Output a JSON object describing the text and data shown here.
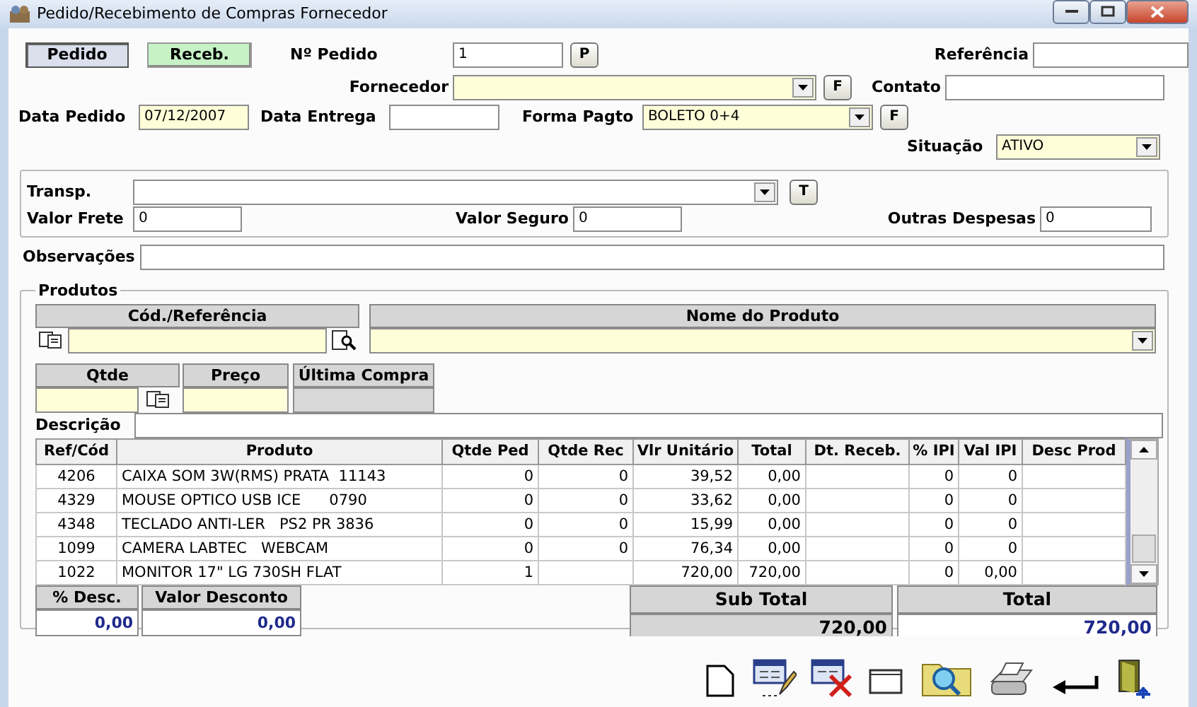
{
  "window": {
    "title": "Pedido/Recebimento de Compras Fornecedor"
  },
  "tabs": [
    {
      "label": "Pedido",
      "selected": true
    },
    {
      "label": "Receb.",
      "selected": false
    }
  ],
  "order": {
    "number": {
      "label": "Nº Pedido",
      "value": "1",
      "button": "P"
    },
    "reference": {
      "label": "Referência"
    },
    "supplier": {
      "label": "Fornecedor",
      "button": "F"
    },
    "contact": {
      "label": "Contato"
    },
    "order_date": {
      "label": "Data Pedido",
      "value": "07/12/2007"
    },
    "delivery_date": {
      "label": "Data Entrega"
    },
    "payment": {
      "label": "Forma Pagto",
      "value": "BOLETO 0+4",
      "button": "F"
    },
    "status": {
      "label": "Situação",
      "value": "ATIVO"
    }
  },
  "transport": {
    "carrier": {
      "label": "Transp.",
      "button": "T"
    },
    "freight": {
      "label": "Valor Frete",
      "value": "0"
    },
    "insurance": {
      "label": "Valor Seguro",
      "value": "0"
    },
    "other": {
      "label": "Outras Despesas",
      "value": "0"
    }
  },
  "notes": {
    "label": "Observações"
  },
  "products": {
    "title": "Produtos",
    "code_header": "Cód./Referência",
    "name_header": "Nome do Produto",
    "qty_header": "Qtde",
    "price_header": "Preço",
    "last_header": "Última Compra",
    "description_label": "Descrição",
    "table": {
      "columns": [
        "Ref/Cód",
        "Produto",
        "Qtde Ped",
        "Qtde Rec",
        "Vlr Unitário",
        "Total",
        "Dt. Receb.",
        "% IPI",
        "Val IPI",
        "Desc Prod"
      ],
      "rows": [
        {
          "ref": "4206",
          "produto": "CAIXA SOM 3W(RMS) PRATA  11143",
          "qtde_ped": "0",
          "qtde_rec": "0",
          "vlr_unitario": "39,52",
          "total": "0,00",
          "pct_ipi": "0",
          "val_ipi": "0"
        },
        {
          "ref": "4329",
          "produto": "MOUSE OPTICO USB ICE      0790",
          "qtde_ped": "0",
          "qtde_rec": "0",
          "vlr_unitario": "33,62",
          "total": "0,00",
          "pct_ipi": "0",
          "val_ipi": "0"
        },
        {
          "ref": "4348",
          "produto": "TECLADO ANTI-LER   PS2 PR 3836",
          "qtde_ped": "0",
          "qtde_rec": "0",
          "vlr_unitario": "15,99",
          "total": "0,00",
          "pct_ipi": "0",
          "val_ipi": "0"
        },
        {
          "ref": "1099",
          "produto": "CAMERA LABTEC   WEBCAM",
          "qtde_ped": "0",
          "qtde_rec": "0",
          "vlr_unitario": "76,34",
          "total": "0,00",
          "pct_ipi": "0",
          "val_ipi": "0"
        },
        {
          "ref": "1022",
          "produto": "MONITOR 17\" LG 730SH FLAT",
          "qtde_ped": "1",
          "vlr_unitario": "720,00",
          "total": "720,00",
          "pct_ipi": "0",
          "val_ipi": "0,00"
        }
      ]
    }
  },
  "totals": {
    "discount_pct": {
      "label": "% Desc.",
      "value": "0,00"
    },
    "discount_value": {
      "label": "Valor Desconto",
      "value": "0,00"
    },
    "subtotal": {
      "label": "Sub Total",
      "value": "720,00"
    },
    "total": {
      "label": "Total",
      "value": "720,00"
    }
  }
}
